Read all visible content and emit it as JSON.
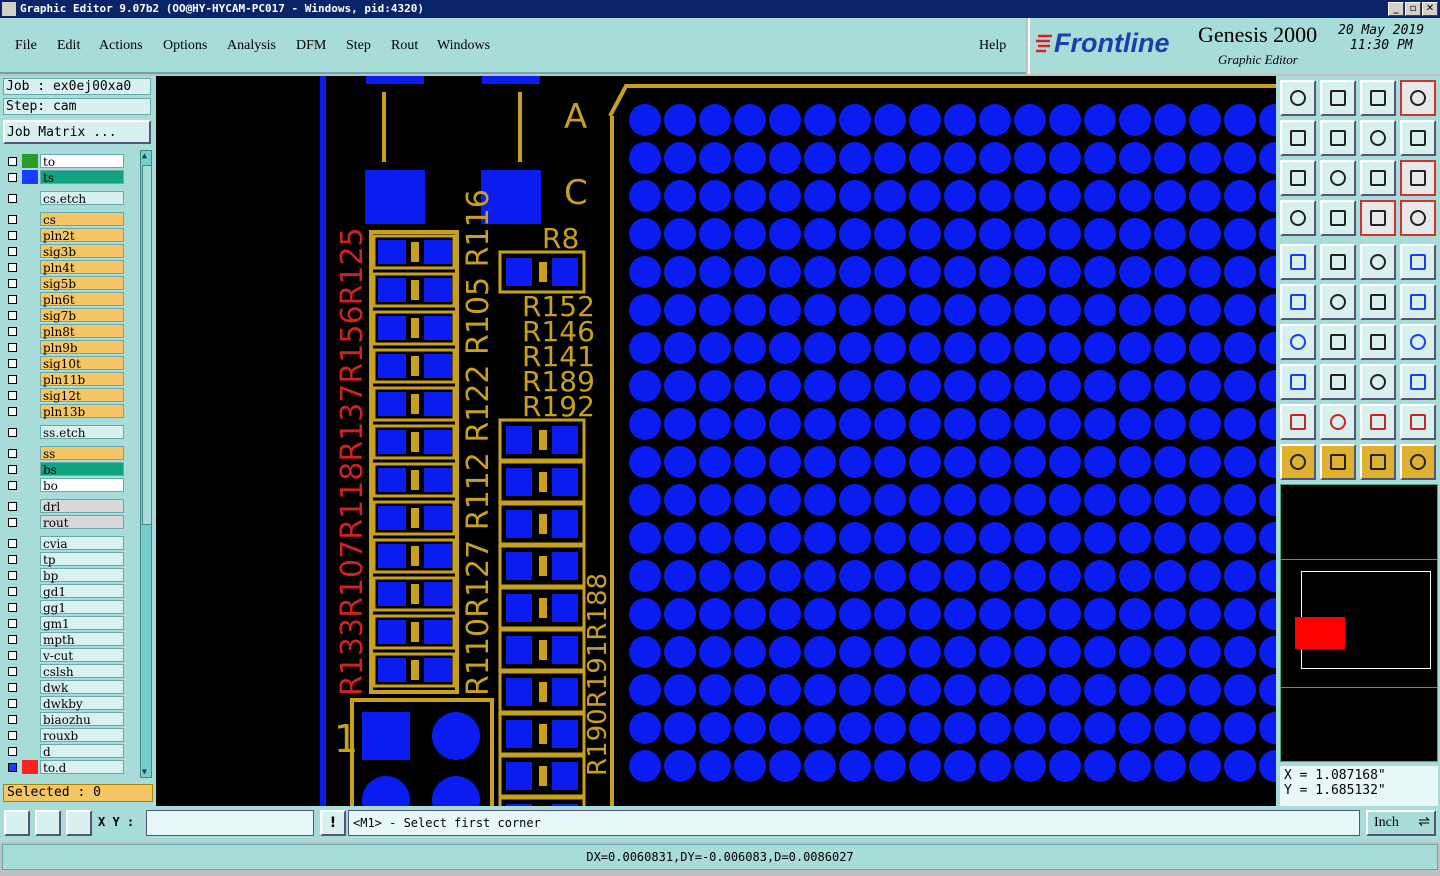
{
  "window": {
    "title": "Graphic Editor 9.07b2 (OO@HY-HYCAM-PC017 - Windows, pid:4320)",
    "buttons": [
      "_",
      "▫",
      "✕"
    ]
  },
  "menu": {
    "items": [
      "File",
      "Edit",
      "Actions",
      "Options",
      "Analysis",
      "DFM",
      "Step",
      "Rout",
      "Windows"
    ],
    "help": "Help"
  },
  "brand": {
    "logo": "Frontline",
    "product": "Genesis 2000",
    "subtitle": "Graphic Editor",
    "date": "20 May 2019",
    "time": "11:30 PM"
  },
  "job": {
    "job_label": "Job : ex0ej00xa0",
    "step_label": "Step: cam",
    "matrix_button": "Job Matrix ..."
  },
  "layers": [
    {
      "name": "to",
      "bg": "#ffffff",
      "swatch": "#2a9a2a",
      "arrow": true
    },
    {
      "name": "ts",
      "bg": "#11a37f",
      "swatch": "#1a3cff",
      "arrow": false
    },
    {
      "name": "cs.etch",
      "bg": "#d8f0ee",
      "swatch": "",
      "arrow": false
    },
    {
      "name": "cs",
      "bg": "#f5c566",
      "swatch": "",
      "arrow": false
    },
    {
      "name": "pln2t",
      "bg": "#f5c566",
      "swatch": "",
      "arrow": true
    },
    {
      "name": "sig3b",
      "bg": "#f5c566",
      "swatch": "",
      "arrow": false
    },
    {
      "name": "pln4t",
      "bg": "#f5c566",
      "swatch": "",
      "arrow": true
    },
    {
      "name": "sig5b",
      "bg": "#f5c566",
      "swatch": "",
      "arrow": true
    },
    {
      "name": "pln6t",
      "bg": "#f5c566",
      "swatch": "",
      "arrow": true
    },
    {
      "name": "sig7b",
      "bg": "#f5c566",
      "swatch": "",
      "arrow": false
    },
    {
      "name": "pln8t",
      "bg": "#f5c566",
      "swatch": "",
      "arrow": true
    },
    {
      "name": "pln9b",
      "bg": "#f5c566",
      "swatch": "",
      "arrow": true
    },
    {
      "name": "sig10t",
      "bg": "#f5c566",
      "swatch": "",
      "arrow": false
    },
    {
      "name": "pln11b",
      "bg": "#f5c566",
      "swatch": "",
      "arrow": true
    },
    {
      "name": "sig12t",
      "bg": "#f5c566",
      "swatch": "",
      "arrow": false
    },
    {
      "name": "pln13b",
      "bg": "#f5c566",
      "swatch": "",
      "arrow": true
    },
    {
      "name": "ss.etch",
      "bg": "#d8f0ee",
      "swatch": "",
      "arrow": false
    },
    {
      "name": "ss",
      "bg": "#f5c566",
      "swatch": "",
      "arrow": false
    },
    {
      "name": "bs",
      "bg": "#11a37f",
      "swatch": "",
      "arrow": false
    },
    {
      "name": "bo",
      "bg": "#ffffff",
      "swatch": "",
      "arrow": true
    },
    {
      "name": "drl",
      "bg": "#d8d8d8",
      "swatch": "",
      "arrow": false
    },
    {
      "name": "rout",
      "bg": "#d8d8d8",
      "swatch": "",
      "arrow": false
    },
    {
      "name": "cvia",
      "bg": "#d8f0ee",
      "swatch": "",
      "arrow": false
    },
    {
      "name": "tp",
      "bg": "#d8f0ee",
      "swatch": "",
      "arrow": false
    },
    {
      "name": "bp",
      "bg": "#d8f0ee",
      "swatch": "",
      "arrow": false
    },
    {
      "name": "gd1",
      "bg": "#d8f0ee",
      "swatch": "",
      "arrow": true
    },
    {
      "name": "gg1",
      "bg": "#d8f0ee",
      "swatch": "",
      "arrow": false
    },
    {
      "name": "gm1",
      "bg": "#d8f0ee",
      "swatch": "",
      "arrow": false
    },
    {
      "name": "mpth",
      "bg": "#d8f0ee",
      "swatch": "",
      "arrow": false
    },
    {
      "name": "v-cut",
      "bg": "#d8f0ee",
      "swatch": "",
      "arrow": false
    },
    {
      "name": "cslsh",
      "bg": "#d8f0ee",
      "swatch": "",
      "arrow": false
    },
    {
      "name": "dwk",
      "bg": "#d8f0ee",
      "swatch": "",
      "arrow": false
    },
    {
      "name": "dwkby",
      "bg": "#d8f0ee",
      "swatch": "",
      "arrow": false
    },
    {
      "name": "biaozhu",
      "bg": "#d8f0ee",
      "swatch": "",
      "arrow": false
    },
    {
      "name": "rouxb",
      "bg": "#d8f0ee",
      "swatch": "",
      "arrow": false
    },
    {
      "name": "d",
      "bg": "#d8f0ee",
      "swatch": "",
      "arrow": false
    },
    {
      "name": "to.d",
      "bg": "#d8f0ee",
      "swatch": "#ff2020",
      "arrow": true
    }
  ],
  "selected": "Selected : 0",
  "canvas": {
    "letters": [
      "A",
      "C"
    ],
    "refdes_right": [
      "R8",
      "R152",
      "R146",
      "R141",
      "R189",
      "R192"
    ],
    "refdes_vertical_mid": "R110R127 R112 R122 R105 R116",
    "refdes_vertical_red": "R133R107R118R137R156R125",
    "refdes_vertical_right": "R190R191R188",
    "pin_label": "1"
  },
  "coords": {
    "x": "X = 1.087168\"",
    "y": "Y = 1.685132\""
  },
  "bottom": {
    "xy_label": "X Y :",
    "xy_value": "",
    "prompt": "<M1> - Select first corner",
    "units": "Inch"
  },
  "status": "DX=0.0060831,DY=-0.006083,D=0.0086027",
  "colors": {
    "pad": "#0a1cf0",
    "gold": "#c8a020",
    "mint": "#a8dcd8"
  }
}
